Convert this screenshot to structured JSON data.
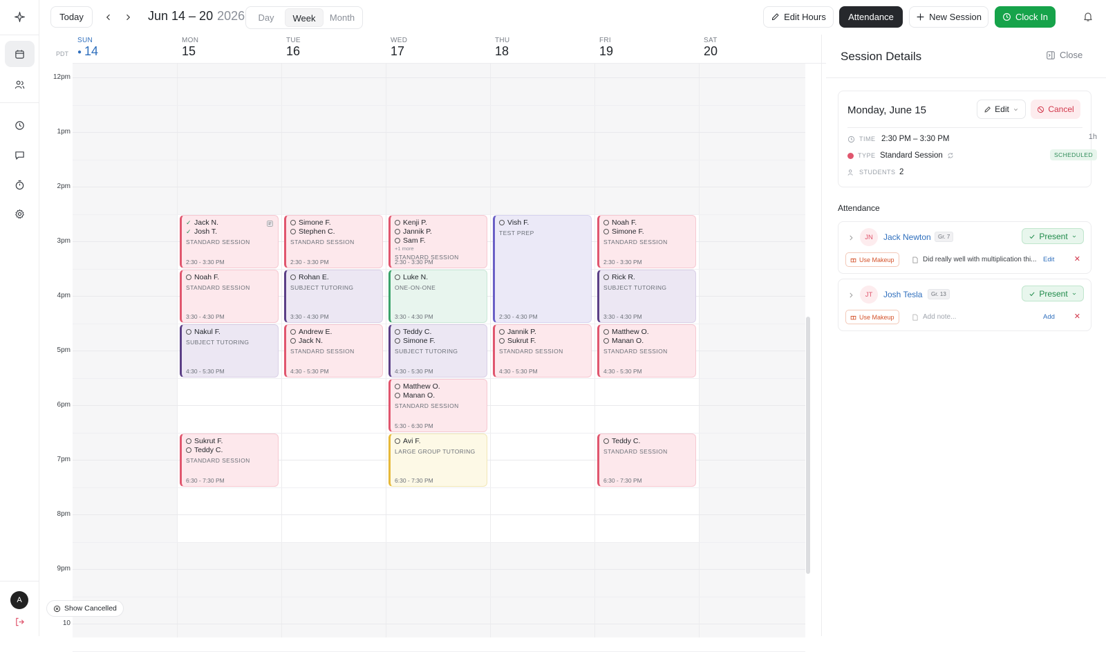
{
  "topbar": {
    "today": "Today",
    "range": "Jun 14 – 20",
    "year": "2026",
    "views": [
      "Day",
      "Week",
      "Month"
    ],
    "active_view": "Week",
    "edit_hours": "Edit Hours",
    "attendance": "Attendance",
    "new_session": "New Session",
    "clock_in": "Clock In"
  },
  "calendar": {
    "timezone": "PDT",
    "days": [
      {
        "name": "SUN",
        "date": "14"
      },
      {
        "name": "MON",
        "date": "15"
      },
      {
        "name": "TUE",
        "date": "16"
      },
      {
        "name": "WED",
        "date": "17"
      },
      {
        "name": "THU",
        "date": "18"
      },
      {
        "name": "FRI",
        "date": "19"
      },
      {
        "name": "SAT",
        "date": "20"
      }
    ],
    "hours": [
      "12pm",
      "1pm",
      "2pm",
      "3pm",
      "4pm",
      "5pm",
      "6pm",
      "7pm",
      "8pm",
      "9pm",
      "10"
    ],
    "show_cancelled": "Show Cancelled",
    "events": [
      {
        "day": 1,
        "start": 14.5,
        "end": 15.5,
        "color": "pink",
        "students": [
          "Jack N.",
          "Josh T."
        ],
        "checked": [
          true,
          true
        ],
        "type": "STANDARD SESSION",
        "time": "2:30 - 3:30 PM",
        "has_note": true
      },
      {
        "day": 1,
        "start": 15.5,
        "end": 16.5,
        "color": "pink",
        "students": [
          "Noah F."
        ],
        "type": "STANDARD SESSION",
        "time": "3:30 - 4:30 PM"
      },
      {
        "day": 1,
        "start": 16.5,
        "end": 17.5,
        "color": "purple",
        "students": [
          "Nakul F."
        ],
        "type": "SUBJECT TUTORING",
        "time": "4:30 - 5:30 PM"
      },
      {
        "day": 1,
        "start": 18.5,
        "end": 19.5,
        "color": "pink",
        "students": [
          "Sukrut F.",
          "Teddy C."
        ],
        "type": "STANDARD SESSION",
        "time": "6:30 - 7:30 PM"
      },
      {
        "day": 2,
        "start": 14.5,
        "end": 15.5,
        "color": "pink",
        "students": [
          "Simone F.",
          "Stephen C."
        ],
        "type": "STANDARD SESSION",
        "time": "2:30 - 3:30 PM"
      },
      {
        "day": 2,
        "start": 15.5,
        "end": 16.5,
        "color": "purple",
        "students": [
          "Rohan E."
        ],
        "type": "SUBJECT TUTORING",
        "time": "3:30 - 4:30 PM"
      },
      {
        "day": 2,
        "start": 16.5,
        "end": 17.5,
        "color": "pink",
        "students": [
          "Andrew E.",
          "Jack N."
        ],
        "type": "STANDARD SESSION",
        "time": "4:30 - 5:30 PM"
      },
      {
        "day": 3,
        "start": 14.5,
        "end": 15.5,
        "color": "pink",
        "students": [
          "Kenji P.",
          "Jannik P.",
          "Sam F."
        ],
        "more": "+1 more",
        "type": "STANDARD SESSION",
        "time": "2:30 - 3:30 PM"
      },
      {
        "day": 3,
        "start": 15.5,
        "end": 16.5,
        "color": "green",
        "students": [
          "Luke N."
        ],
        "type": "ONE-ON-ONE",
        "time": "3:30 - 4:30 PM"
      },
      {
        "day": 3,
        "start": 16.5,
        "end": 17.5,
        "color": "purple",
        "students": [
          "Teddy C.",
          "Simone F."
        ],
        "type": "SUBJECT TUTORING",
        "time": "4:30 - 5:30 PM"
      },
      {
        "day": 3,
        "start": 17.5,
        "end": 18.5,
        "color": "pink",
        "students": [
          "Matthew O.",
          "Manan O."
        ],
        "type": "STANDARD SESSION",
        "time": "5:30 - 6:30 PM"
      },
      {
        "day": 3,
        "start": 18.5,
        "end": 19.5,
        "color": "yellow",
        "students": [
          "Avi F."
        ],
        "type": "LARGE GROUP TUTORING",
        "time": "6:30 - 7:30 PM"
      },
      {
        "day": 4,
        "start": 14.5,
        "end": 16.5,
        "color": "lav",
        "students": [
          "Vish F."
        ],
        "type": "TEST PREP",
        "time": "2:30 - 4:30 PM"
      },
      {
        "day": 4,
        "start": 16.5,
        "end": 17.5,
        "color": "pink",
        "students": [
          "Jannik P.",
          "Sukrut F."
        ],
        "type": "STANDARD SESSION",
        "time": "4:30 - 5:30 PM"
      },
      {
        "day": 5,
        "start": 14.5,
        "end": 15.5,
        "color": "pink",
        "students": [
          "Noah F.",
          "Simone F."
        ],
        "type": "STANDARD SESSION",
        "time": "2:30 - 3:30 PM"
      },
      {
        "day": 5,
        "start": 15.5,
        "end": 16.5,
        "color": "purple",
        "students": [
          "Rick R."
        ],
        "type": "SUBJECT TUTORING",
        "time": "3:30 - 4:30 PM"
      },
      {
        "day": 5,
        "start": 16.5,
        "end": 17.5,
        "color": "pink",
        "students": [
          "Matthew O.",
          "Manan O."
        ],
        "type": "STANDARD SESSION",
        "time": "4:30 - 5:30 PM"
      },
      {
        "day": 5,
        "start": 18.5,
        "end": 19.5,
        "color": "pink",
        "students": [
          "Teddy C."
        ],
        "type": "STANDARD SESSION",
        "time": "6:30 - 7:30 PM"
      }
    ]
  },
  "panel": {
    "title": "Session Details",
    "close": "Close",
    "date": "Monday, June 15",
    "edit": "Edit",
    "cancel": "Cancel",
    "time_label": "TIME",
    "time_value": "2:30 PM – 3:30 PM",
    "duration": "1h",
    "type_label": "TYPE",
    "type_value": "Standard Session",
    "status": "SCHEDULED",
    "students_label": "STUDENTS",
    "students_value": "2",
    "attendance_title": "Attendance",
    "attendance": [
      {
        "initials": "JN",
        "name": "Jack Newton",
        "grade": "Gr. 7",
        "status": "Present",
        "makeup": "Use Makeup",
        "note": "Did really well with multiplication thi...",
        "note_action": "Edit",
        "placeholder": false
      },
      {
        "initials": "JT",
        "name": "Josh Tesla",
        "grade": "Gr. 13",
        "status": "Present",
        "makeup": "Use Makeup",
        "note": "Add note...",
        "note_action": "Add",
        "placeholder": true
      }
    ]
  },
  "user": {
    "avatar": "A"
  },
  "colors": {
    "accent_green": "#16a34a",
    "today_blue": "#2f6fbd",
    "pink": "#e0566e"
  }
}
